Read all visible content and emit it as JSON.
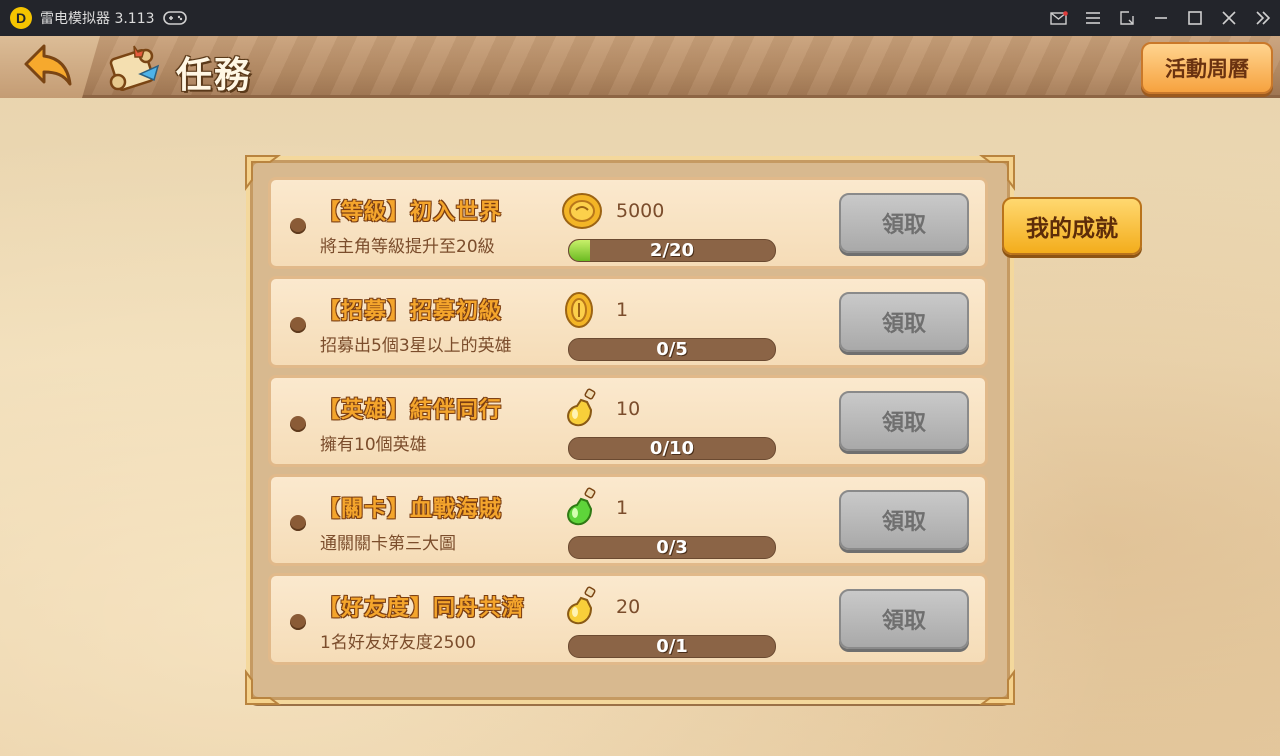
{
  "window": {
    "title": "雷电模拟器 3.113",
    "logo_glyph": "D",
    "buttons": [
      "mail-icon",
      "menu-icon",
      "screen-icon",
      "minimize-icon",
      "maximize-icon",
      "close-icon",
      "expand-sidebar-icon"
    ]
  },
  "header": {
    "title": "任務",
    "calendar_label": "活動周曆"
  },
  "side": {
    "achievement_label": "我的成就"
  },
  "tasks": [
    {
      "title": "【等級】初入世界",
      "desc": "將主角等級提升至20級",
      "reward_icon": "gold-coin-icon",
      "reward_amount": "5000",
      "progress_text": "2/20",
      "progress_fraction": 0.1,
      "claim_label": "領取"
    },
    {
      "title": "【招募】招募初級",
      "desc": "招募出5個3星以上的英雄",
      "reward_icon": "recruit-coin-icon",
      "reward_amount": "1",
      "progress_text": "0/5",
      "progress_fraction": 0,
      "claim_label": "領取"
    },
    {
      "title": "【英雄】結伴同行",
      "desc": "擁有10個英雄",
      "reward_icon": "yellow-potion-icon",
      "reward_amount": "10",
      "progress_text": "0/10",
      "progress_fraction": 0,
      "claim_label": "領取"
    },
    {
      "title": "【關卡】血戰海賊",
      "desc": "通關關卡第三大圖",
      "reward_icon": "green-potion-icon",
      "reward_amount": "1",
      "progress_text": "0/3",
      "progress_fraction": 0,
      "claim_label": "領取"
    },
    {
      "title": "【好友度】同舟共濟",
      "desc": "1名好友好友度2500",
      "reward_icon": "yellow-potion-icon",
      "reward_amount": "20",
      "progress_text": "0/1",
      "progress_fraction": 0,
      "claim_label": "領取"
    }
  ],
  "colors": {
    "titlebar_bg": "#23252b",
    "panel_bg": "#d8b98f",
    "task_title": "#f4a52c",
    "claim_disabled": "#a9a9a9",
    "progress_fill": "#6cbb22",
    "achievement_button": "#f3ad1c"
  }
}
